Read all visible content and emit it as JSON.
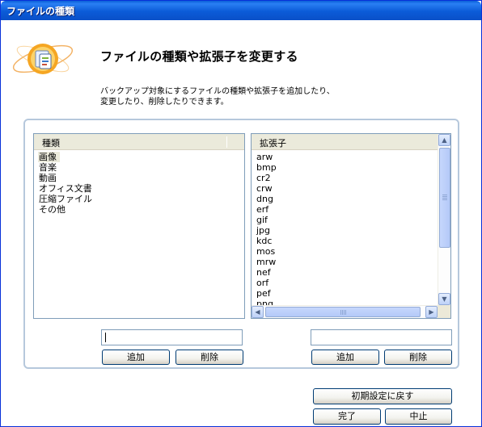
{
  "window": {
    "title": "ファイルの種類"
  },
  "header": {
    "title": "ファイルの種類や拡張子を変更する",
    "description": "バックアップ対象にするファイルの種類や拡張子を追加したり、\n変更したり、削除したりできます。"
  },
  "types_list": {
    "header": "種類",
    "items": [
      "画像",
      "音楽",
      "動画",
      "オフィス文書",
      "圧縮ファイル",
      "その他"
    ],
    "selected_index": 0
  },
  "extensions_list": {
    "header": "拡張子",
    "items": [
      "arw",
      "bmp",
      "cr2",
      "crw",
      "dng",
      "erf",
      "gif",
      "jpg",
      "kdc",
      "mos",
      "mrw",
      "nef",
      "orf",
      "pef",
      "png"
    ]
  },
  "left_controls": {
    "input_value": "",
    "add_label": "追加",
    "delete_label": "削除"
  },
  "right_controls": {
    "input_value": "",
    "add_label": "追加",
    "delete_label": "削除"
  },
  "footer": {
    "reset_label": "初期設定に戻す",
    "ok_label": "完了",
    "cancel_label": "中止"
  },
  "colors": {
    "titlebar": "#0a5fd8",
    "group_border": "#b6c8dc",
    "list_border": "#7f9db9",
    "header_bg": "#ebeadb"
  }
}
